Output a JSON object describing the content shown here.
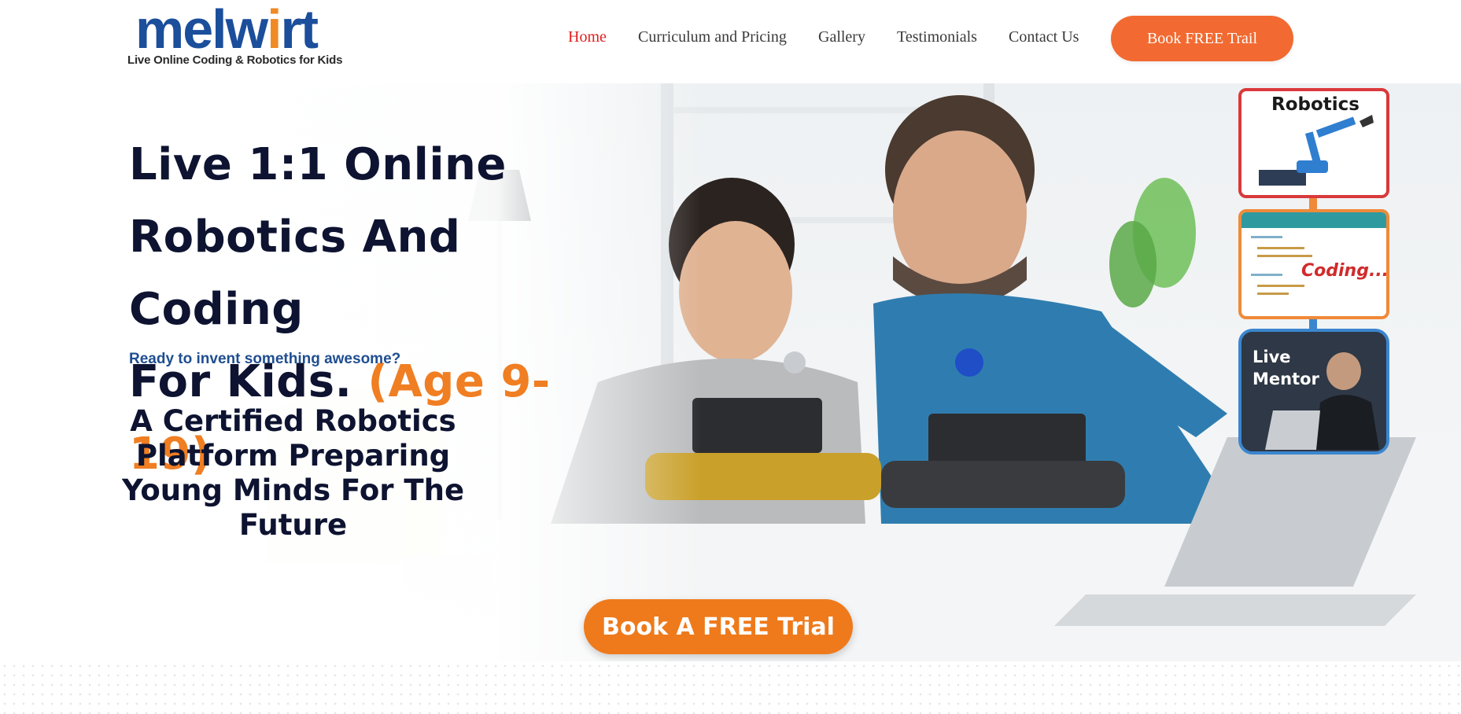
{
  "brand": {
    "name_pre": "melw",
    "name_i": "i",
    "name_post": "rt",
    "tagline": "Live Online Coding & Robotics for Kids"
  },
  "nav": {
    "items": [
      {
        "label": "Home",
        "active": true
      },
      {
        "label": "Curriculum and Pricing",
        "active": false
      },
      {
        "label": "Gallery",
        "active": false
      },
      {
        "label": "Testimonials",
        "active": false
      },
      {
        "label": "Contact Us",
        "active": false
      }
    ],
    "cta_label": "Book FREE Trail"
  },
  "hero": {
    "title_line1": "Live 1:1 Online",
    "title_line2": "Robotics And Coding",
    "title_line3": "For Kids.",
    "title_age": "(Age 9-19)",
    "tagline": "Ready to invent something awesome?",
    "subheading": "A Certified Robotics Platform Preparing Young Minds For The Future",
    "cta_label": "Book A FREE Trial"
  },
  "side_cards": {
    "robotics": "Robotics",
    "coding": "Coding...",
    "mentor": "Live Mentor"
  },
  "colors": {
    "brand_blue": "#1b4e9b",
    "brand_orange": "#f26a31",
    "active_nav": "#e0201f",
    "heading_dark": "#0d1330",
    "age_orange": "#f07e22",
    "tagline_blue": "#1f4e91",
    "trial_orange": "#ee7a1c"
  },
  "icons": {
    "robot_arm": "robot-arm-icon",
    "code_editor": "code-editor-icon",
    "mentor": "mentor-laptop-icon"
  }
}
